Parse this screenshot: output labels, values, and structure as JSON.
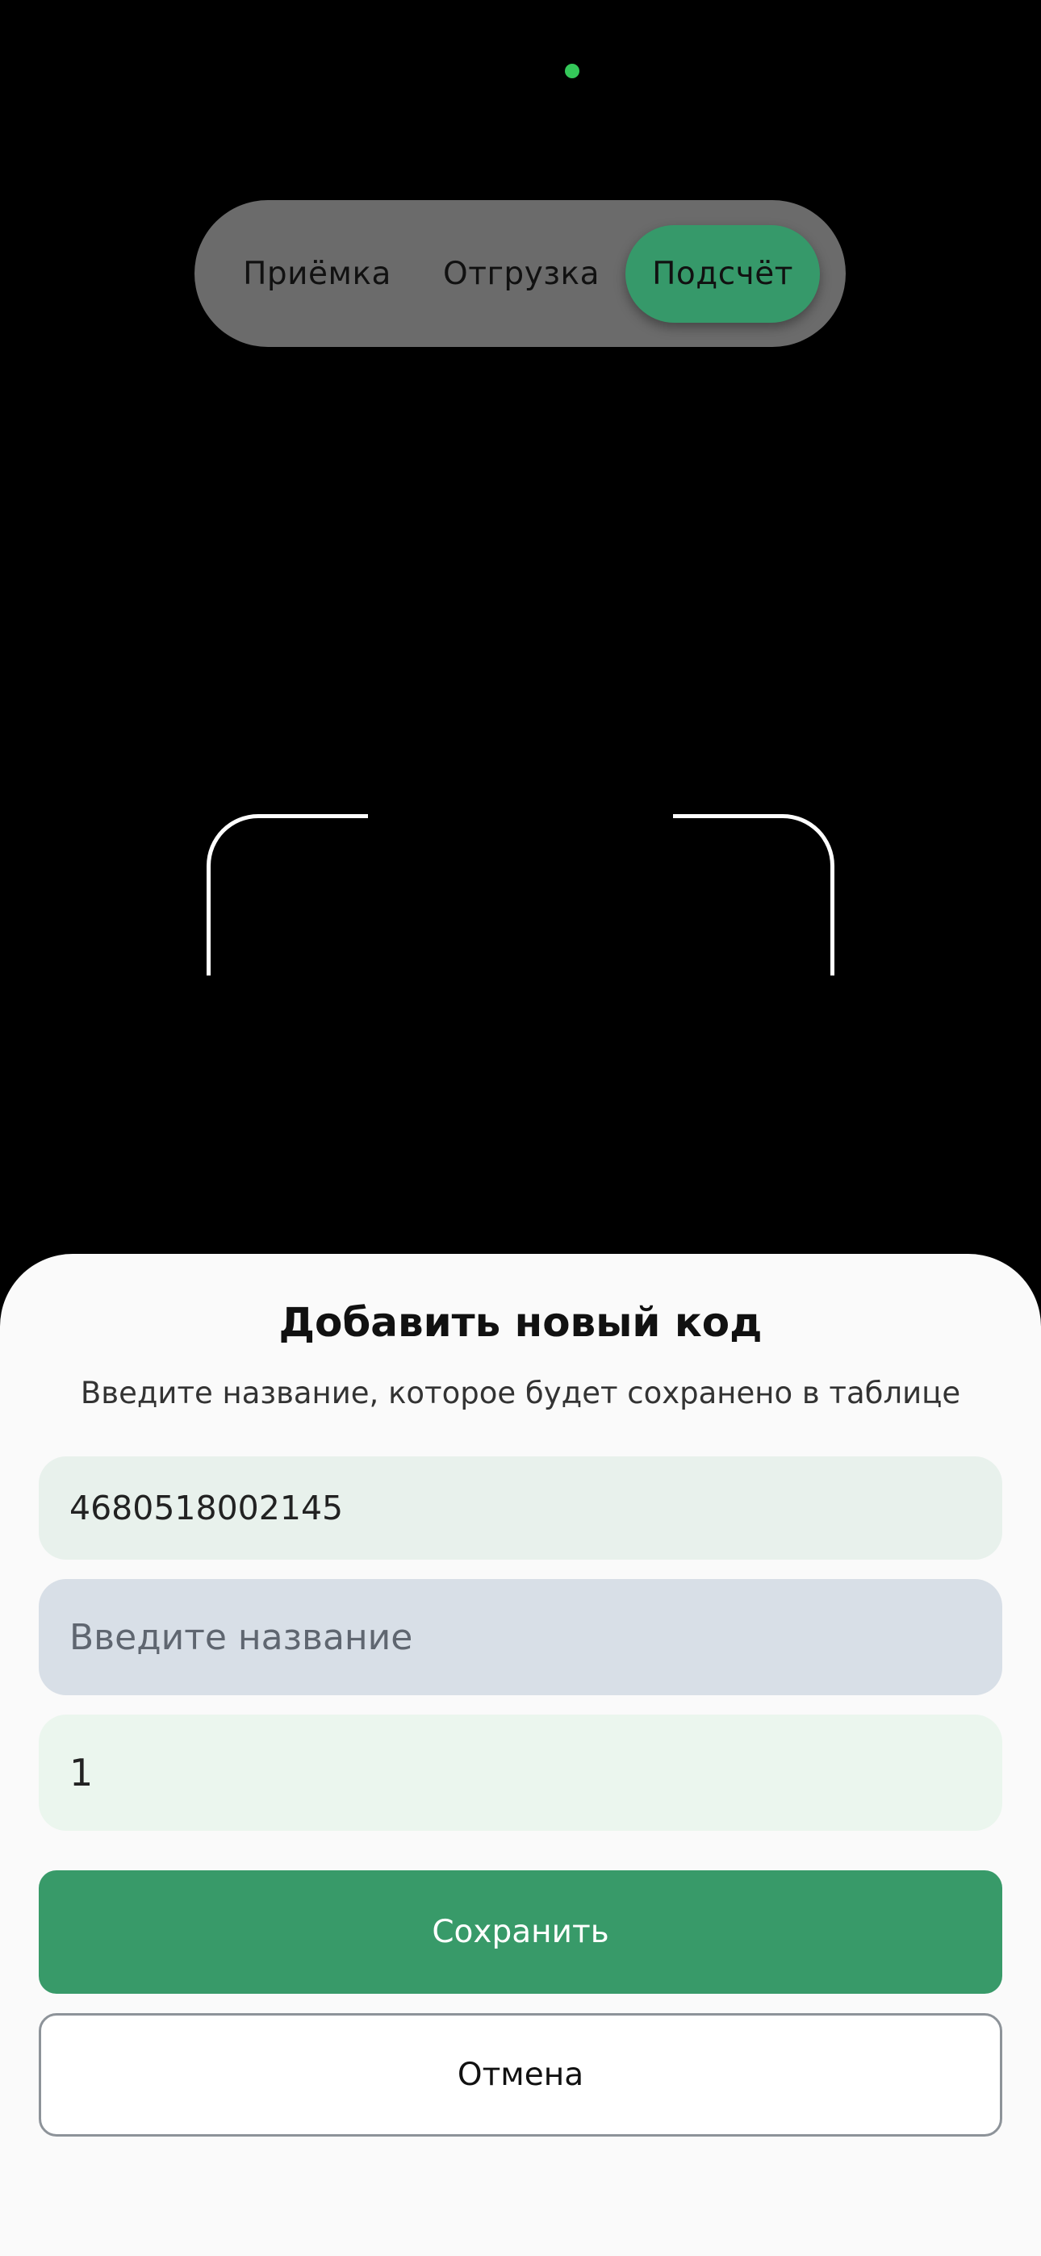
{
  "modes": {
    "tabs": [
      {
        "label": "Приёмка",
        "active": false
      },
      {
        "label": "Отгрузка",
        "active": false
      },
      {
        "label": "Подсчёт",
        "active": true
      }
    ]
  },
  "dialog": {
    "title": "Добавить новый код",
    "subtitle": "Введите название, которое будет сохранено в таблице",
    "code_value": "4680518002145",
    "name_placeholder": "Введите название",
    "name_value": "",
    "quantity_value": "1",
    "save_label": "Сохранить",
    "cancel_label": "Отмена"
  },
  "colors": {
    "accent": "#36996a",
    "camera_indicator": "#34c759",
    "background": "#000000",
    "sheet": "#fafafa"
  }
}
